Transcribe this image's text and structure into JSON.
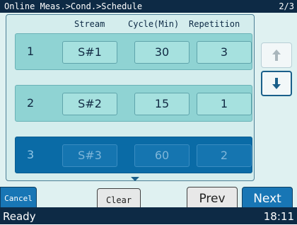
{
  "titlebar": {
    "breadcrumb": "Online Meas.>Cond.>Schedule",
    "page": "2/3"
  },
  "table": {
    "headers": {
      "stream": "Stream",
      "cycle": "Cycle(Min)",
      "repetition": "Repetition"
    },
    "rows": [
      {
        "num": "1",
        "stream": "S#1",
        "cycle": "30",
        "repetition": "3",
        "selected": false
      },
      {
        "num": "2",
        "stream": "S#2",
        "cycle": "15",
        "repetition": "1",
        "selected": false
      },
      {
        "num": "3",
        "stream": "S#3",
        "cycle": "60",
        "repetition": "2",
        "selected": true
      }
    ]
  },
  "icons": {
    "scroll_up": "arrow-up-icon",
    "scroll_down": "arrow-down-icon",
    "more_below": "triangle-down-icon"
  },
  "buttons": {
    "cancel": "Cancel",
    "clear": "Clear",
    "prev": "Prev",
    "next": "Next"
  },
  "status": {
    "text": "Ready",
    "time": "18:11"
  },
  "colors": {
    "title_bg": "#0d2a45",
    "row_normal": "#8fd3d3",
    "row_selected": "#0a6ba6",
    "accent_blue": "#1876b5"
  }
}
